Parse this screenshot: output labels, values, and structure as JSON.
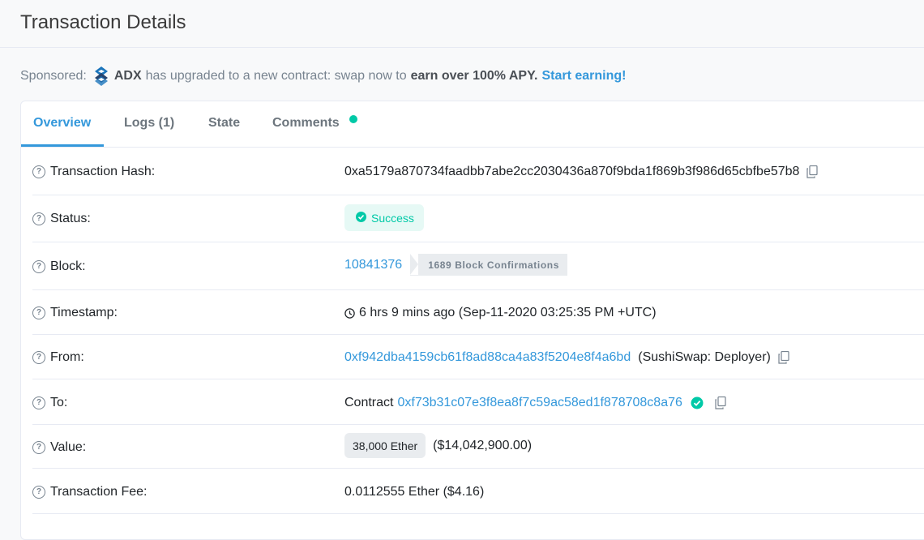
{
  "page": {
    "title": "Transaction Details"
  },
  "sponsor": {
    "prefix": "Sponsored:",
    "brand": "ADX",
    "text": "has upgraded to a new contract: swap now to",
    "emphasis": "earn over 100% APY.",
    "cta": "Start earning!",
    "logo_icon": "adx-logo-icon"
  },
  "tabs": [
    {
      "label": "Overview",
      "active": true
    },
    {
      "label": "Logs (1)",
      "active": false
    },
    {
      "label": "State",
      "active": false
    },
    {
      "label": "Comments",
      "active": false
    }
  ],
  "colors": {
    "accent": "#3498db",
    "success": "#00c9a7",
    "text": "#212529",
    "muted": "#77838f"
  },
  "fields": {
    "hash": {
      "label": "Transaction Hash:",
      "value": "0xa5179a870734faadbb7abe2cc2030436a870f9bda1f869b3f986d65cbfbe57b8"
    },
    "status": {
      "label": "Status:",
      "value": "Success"
    },
    "block": {
      "label": "Block:",
      "number": "10841376",
      "confirmations": "1689 Block Confirmations"
    },
    "timestamp": {
      "label": "Timestamp:",
      "value": "6 hrs 9 mins ago (Sep-11-2020 03:25:35 PM +UTC)"
    },
    "from": {
      "label": "From:",
      "address": "0xf942dba4159cb61f8ad88ca4a83f5204e8f4a6bd",
      "tag": "(SushiSwap: Deployer)"
    },
    "to": {
      "label": "To:",
      "prefix": "Contract",
      "address": "0xf73b31c07e3f8ea8f7c59ac58ed1f878708c8a76"
    },
    "value": {
      "label": "Value:",
      "amount": "38,000 Ether",
      "usd": "($14,042,900.00)"
    },
    "fee": {
      "label": "Transaction Fee:",
      "value": "0.0112555 Ether ($4.16)"
    }
  }
}
